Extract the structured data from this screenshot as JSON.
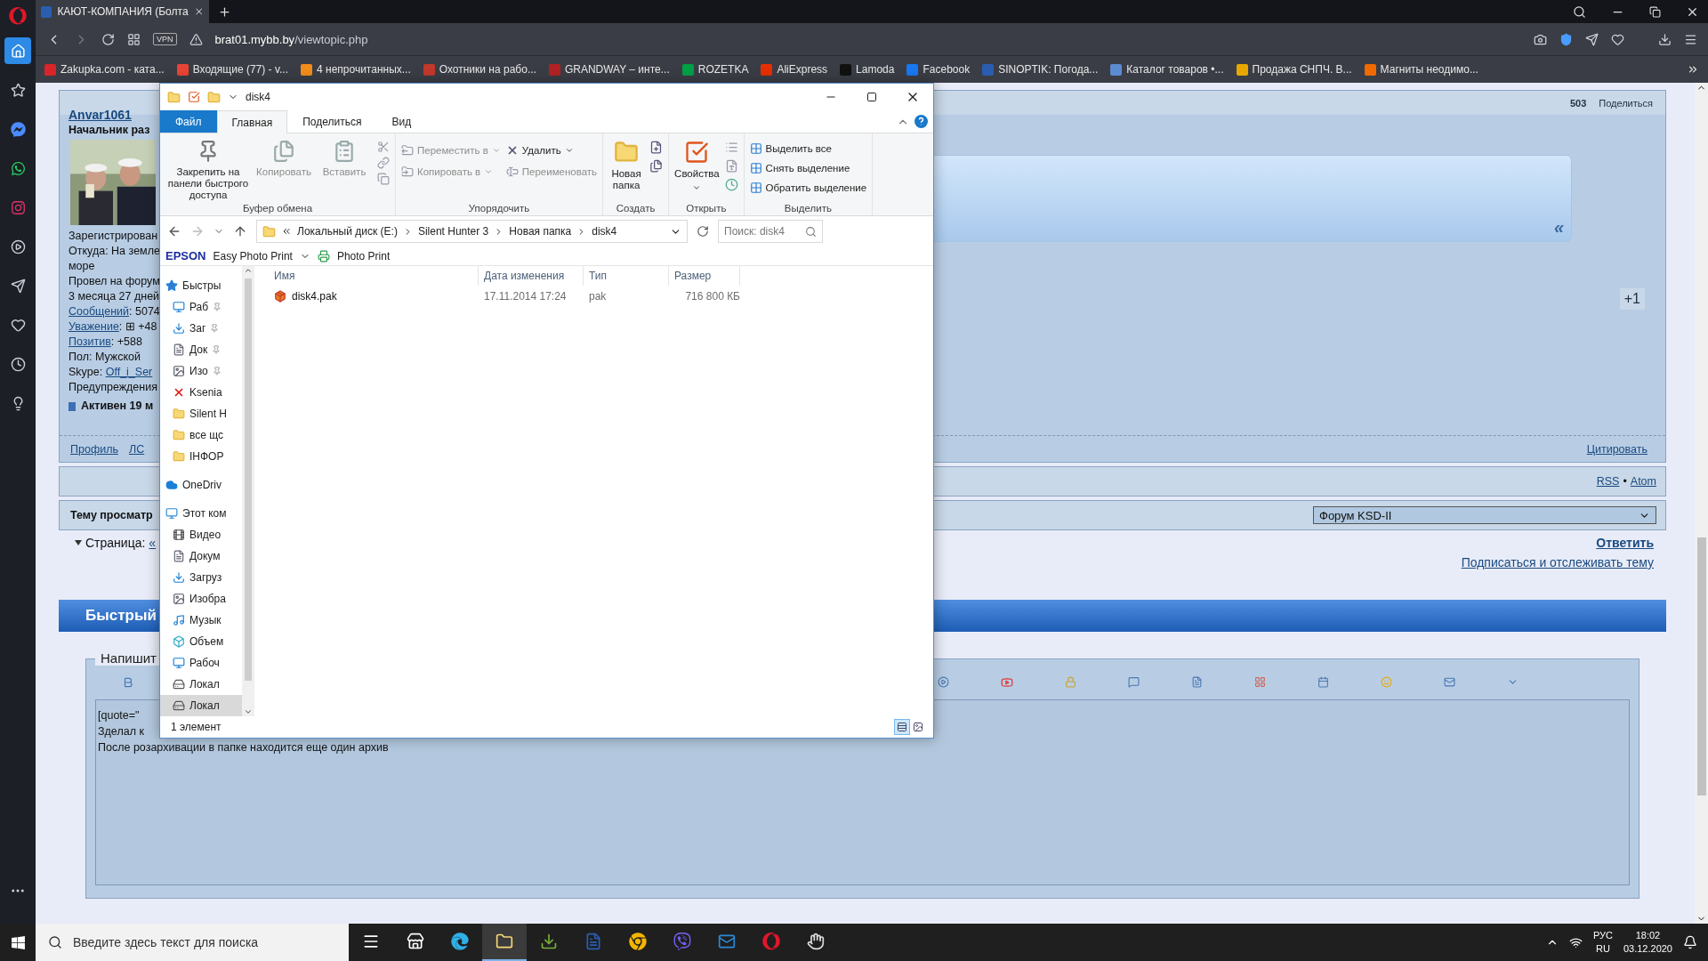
{
  "browser": {
    "tabs": [
      {
        "title": "КАЮТ-КОМПАНИЯ (Болта",
        "selected": true
      }
    ],
    "vpn_badge": "VPN",
    "address": {
      "domain": "brat01.mybb.by",
      "path": "/viewtopic.php"
    },
    "bookmarks": [
      {
        "title": "Zakupka.com - ката...",
        "color": "#d8252a"
      },
      {
        "title": "Входящие (77) - v...",
        "color": "#ea4335"
      },
      {
        "title": "4 непрочитанных...",
        "color": "#f28c1b"
      },
      {
        "title": "Охотники на рабо...",
        "color": "#c0392b"
      },
      {
        "title": "GRANDWAY – инте...",
        "color": "#b22222"
      },
      {
        "title": "ROZETKA",
        "color": "#00a046"
      },
      {
        "title": "AliExpress",
        "color": "#e62e04"
      },
      {
        "title": "Lamoda",
        "color": "#111111"
      },
      {
        "title": "Facebook",
        "color": "#1877f2"
      },
      {
        "title": "SINOPTIK: Погода...",
        "color": "#2a5db0"
      },
      {
        "title": "Каталог товаров •...",
        "color": "#5b8bd0"
      },
      {
        "title": "Продажа СНПЧ. В...",
        "color": "#e7a700"
      },
      {
        "title": "Магниты неодимо...",
        "color": "#f06a00"
      }
    ]
  },
  "opera_sidebar": {
    "items": [
      {
        "selected": true
      },
      {
        "selected": false
      },
      {
        "selected": false
      },
      {
        "selected": false
      },
      {
        "selected": false
      },
      {
        "selected": false
      },
      {
        "selected": false
      },
      {
        "selected": false
      },
      {
        "selected": false
      },
      {
        "selected": false
      }
    ]
  },
  "forum": {
    "author": {
      "name": "Anvar1061",
      "rank": "Начальник раз",
      "details": [
        {
          "parts": [
            {
              "text": "Зарегистрирован",
              "link": false
            }
          ]
        },
        {
          "parts": [
            {
              "text": "Откуда: На земле",
              "link": false
            }
          ]
        },
        {
          "parts": [
            {
              "text": "море",
              "link": false
            }
          ]
        },
        {
          "parts": [
            {
              "text": "Провел на форум",
              "link": false
            }
          ]
        },
        {
          "parts": [
            {
              "text": "3 месяца 27 дней",
              "link": false
            }
          ]
        },
        {
          "parts": [
            {
              "text": "Сообщений",
              "link": true
            },
            {
              "text": ": 5074",
              "link": false
            }
          ]
        },
        {
          "parts": [
            {
              "text": "Уважение",
              "link": true
            },
            {
              "text": ": ⊞ +48",
              "link": false
            }
          ]
        },
        {
          "parts": [
            {
              "text": "Позитив",
              "link": true
            },
            {
              "text": ": +588",
              "link": false
            }
          ]
        },
        {
          "parts": [
            {
              "text": "Пол: Мужской",
              "link": false
            }
          ]
        },
        {
          "parts": [
            {
              "text": "Skype: ",
              "link": false
            },
            {
              "text": "Off_i_Ser",
              "link": true
            }
          ]
        },
        {
          "parts": [
            {
              "text": "Предупреждения",
              "link": false
            }
          ]
        }
      ],
      "status": "Активен 19 м"
    },
    "post_links": [
      "Профиль",
      "ЛС"
    ],
    "post_number": "503",
    "share": "Поделиться",
    "plus_one": "+1",
    "quote_mark": "«",
    "quote_link": "Цитировать",
    "feeds": [
      "RSS",
      "•",
      "Atom"
    ],
    "viewers_label": "Тему просматр",
    "forum_select": "Форум KSD-II",
    "pagination": {
      "label": "Страница:",
      "first": "«"
    },
    "reply": "Ответить",
    "subscribe": "Подписаться и отслеживать тему",
    "quick_reply": {
      "title": "Быстрый",
      "legend": "Напишит",
      "text_lines": [
        "[quote=\"",
        "Зделал к",
        "После розархивации в папке находится еще один архив"
      ]
    }
  },
  "explorer": {
    "title": "disk4",
    "ribbon_tabs": [
      {
        "label": "Файл",
        "kind": "file",
        "selected": false
      },
      {
        "label": "Главная",
        "kind": "tab",
        "selected": true
      },
      {
        "label": "Поделиться",
        "kind": "tab",
        "selected": false
      },
      {
        "label": "Вид",
        "kind": "tab",
        "selected": false
      }
    ],
    "groups": [
      {
        "label": "Буфер обмена",
        "kind": "clipboard",
        "buttons": [
          {
            "label": "Закрепить на панели быстрого доступа",
            "disabled": false
          },
          {
            "label": "Копировать",
            "disabled": true
          },
          {
            "label": "Вставить",
            "disabled": true
          }
        ]
      },
      {
        "label": "Упорядочить",
        "kind": "organize",
        "buttons": [
          {
            "label": "Переместить в",
            "disabled": true
          },
          {
            "label": "Удалить",
            "disabled": false
          },
          {
            "label": "Копировать в",
            "disabled": true
          },
          {
            "label": "Переименовать",
            "disabled": true
          }
        ]
      },
      {
        "label": "Создать",
        "kind": "new",
        "buttons": [
          {
            "label": "Новая папка",
            "disabled": false
          }
        ]
      },
      {
        "label": "Открыть",
        "kind": "open",
        "buttons": [
          {
            "label": "Свойства",
            "disabled": false
          }
        ]
      },
      {
        "label": "Выделить",
        "kind": "select",
        "buttons": [
          {
            "label": "Выделить все",
            "disabled": false
          },
          {
            "label": "Снять выделение",
            "disabled": false
          },
          {
            "label": "Обратить выделение",
            "disabled": false
          }
        ]
      }
    ],
    "breadcrumb": [
      "Локальный диск (E:)",
      "Silent Hunter 3",
      "Новая папка",
      "disk4"
    ],
    "search_placeholder": "Поиск: disk4",
    "epson": {
      "brand": "EPSON",
      "app": "Easy Photo Print",
      "action": "Photo Print"
    },
    "nav": [
      {
        "label": "Быстры",
        "kind": "quick",
        "selected": false,
        "children": [
          {
            "label": "Раб",
            "kind": "desktop",
            "pinned": true,
            "selected": false
          },
          {
            "label": "Заг",
            "kind": "downloads",
            "pinned": true,
            "selected": false
          },
          {
            "label": "Док",
            "kind": "documents",
            "pinned": true,
            "selected": false
          },
          {
            "label": "Изо",
            "kind": "pictures",
            "pinned": true,
            "selected": false
          },
          {
            "label": "Ksenia",
            "kind": "error",
            "pinned": false,
            "selected": false
          },
          {
            "label": "Silent H",
            "kind": "folder",
            "pinned": false,
            "selected": false
          },
          {
            "label": "все щс",
            "kind": "folder",
            "pinned": false,
            "selected": false
          },
          {
            "label": "ІНФОР",
            "kind": "folder",
            "pinned": false,
            "selected": false
          }
        ]
      },
      {
        "label": "OneDriv",
        "kind": "cloud",
        "selected": false
      },
      {
        "label": "Этот ком",
        "kind": "computer",
        "selected": false,
        "children": [
          {
            "label": "Видео",
            "kind": "videos",
            "pinned": false,
            "selected": false
          },
          {
            "label": "Докум",
            "kind": "documents",
            "pinned": false,
            "selected": false
          },
          {
            "label": "Загруз",
            "kind": "downloads",
            "pinned": false,
            "selected": false
          },
          {
            "label": "Изобра",
            "kind": "pictures",
            "pinned": false,
            "selected": false
          },
          {
            "label": "Музык",
            "kind": "music",
            "pinned": false,
            "selected": false
          },
          {
            "label": "Объем",
            "kind": "objects",
            "pinned": false,
            "selected": false
          },
          {
            "label": "Рабоч",
            "kind": "desktop",
            "pinned": false,
            "selected": false
          },
          {
            "label": "Локал",
            "kind": "drive",
            "pinned": false,
            "selected": false
          },
          {
            "label": "Локал",
            "kind": "drive",
            "pinned": false,
            "selected": true
          }
        ]
      }
    ],
    "columns": [
      "Имя",
      "Дата изменения",
      "Тип",
      "Размер"
    ],
    "rows": [
      {
        "cells": [
          "disk4.pak",
          "17.11.2014 17:24",
          "pak",
          "716 800 КБ"
        ],
        "selected": false
      }
    ],
    "status": "1 элемент",
    "views": [
      {
        "selected": true
      },
      {
        "selected": false
      }
    ]
  },
  "taskbar": {
    "search_placeholder": "Введите здесь текст для поиска",
    "apps": [
      {
        "active": false
      },
      {
        "active": false
      },
      {
        "active": false
      },
      {
        "active": true
      },
      {
        "active": false
      },
      {
        "active": false
      },
      {
        "active": false
      },
      {
        "active": false
      },
      {
        "active": false
      },
      {
        "active": false
      },
      {
        "active": false
      }
    ],
    "lang": [
      "РУС",
      "RU"
    ],
    "time": "18:02",
    "date": "03.12.2020"
  }
}
